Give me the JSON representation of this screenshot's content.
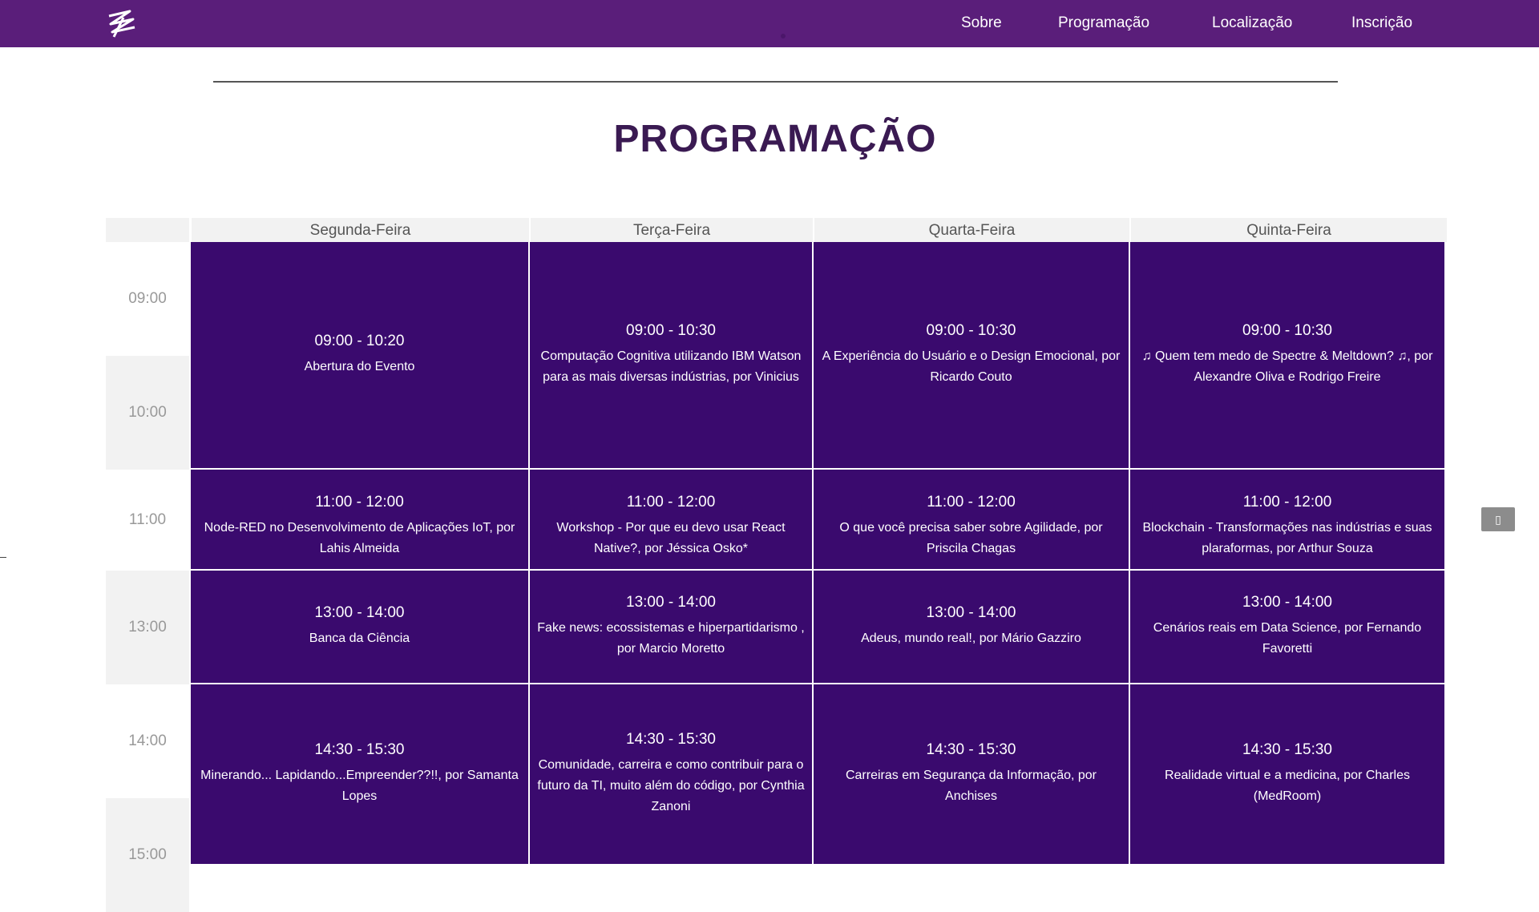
{
  "nav": {
    "logo_icon": "zigzag-logo-icon",
    "links": [
      "Sobre",
      "Programação",
      "Localização",
      "Inscrição"
    ]
  },
  "page": {
    "title": "PROGRAMAÇÃO"
  },
  "schedule": {
    "days": [
      "Segunda-Feira",
      "Terça-Feira",
      "Quarta-Feira",
      "Quinta-Feira"
    ],
    "times": [
      "09:00",
      "10:00",
      "11:00",
      "13:00",
      "14:00",
      "15:00"
    ],
    "rows": [
      [
        {
          "time": "09:00 - 10:20",
          "title": "Abertura do Evento"
        },
        {
          "time": "09:00 - 10:30",
          "title": "Computação Cognitiva utilizando IBM Watson para as mais diversas indústrias, por Vinicius"
        },
        {
          "time": "09:00 - 10:30",
          "title": "A Experiência do Usuário e o Design Emocional, por Ricardo Couto"
        },
        {
          "time": "09:00 - 10:30",
          "title": "♫ Quem tem medo de Spectre & Meltdown? ♫, por Alexandre Oliva e Rodrigo Freire"
        }
      ],
      [
        {
          "time": "11:00 - 12:00",
          "title": "Node-RED no Desenvolvimento de Aplicações IoT, por Lahis Almeida"
        },
        {
          "time": "11:00 - 12:00",
          "title": "Workshop - Por que eu devo usar React Native?, por Jéssica Osko*"
        },
        {
          "time": "11:00 - 12:00",
          "title": "O que você precisa saber sobre Agilidade, por Priscila Chagas"
        },
        {
          "time": "11:00 - 12:00",
          "title": "Blockchain - Transformações nas indústrias e suas plaraformas, por Arthur Souza"
        }
      ],
      [
        {
          "time": "13:00 - 14:00",
          "title": "Banca da Ciência"
        },
        {
          "time": "13:00 - 14:00",
          "title": "Fake news: ecossistemas e hiperpartidarismo , por Marcio Moretto"
        },
        {
          "time": "13:00 - 14:00",
          "title": "Adeus, mundo real!, por Mário Gazziro"
        },
        {
          "time": "13:00 - 14:00",
          "title": "Cenários reais em Data Science, por Fernando Favoretti"
        }
      ],
      [
        {
          "time": "14:30 - 15:30",
          "title": "Minerando... Lapidando...Empreender??!!, por Samanta Lopes"
        },
        {
          "time": "14:30 - 15:30",
          "title": "Comunidade, carreira e como contribuir para o futuro da TI, muito além do código, por Cynthia Zanoni"
        },
        {
          "time": "14:30 - 15:30",
          "title": "Carreiras em Segurança da Informação, por Anchises"
        },
        {
          "time": "14:30 - 15:30",
          "title": "Realidade virtual e a medicina, por Charles (MedRoom)"
        }
      ]
    ]
  },
  "colors": {
    "nav_bg": "#5a1e7a",
    "slot_bg": "#3a0a6e",
    "title": "#3a1a52"
  },
  "scroll_button": {
    "icon": "scroll-top-icon",
    "label": "▯"
  }
}
